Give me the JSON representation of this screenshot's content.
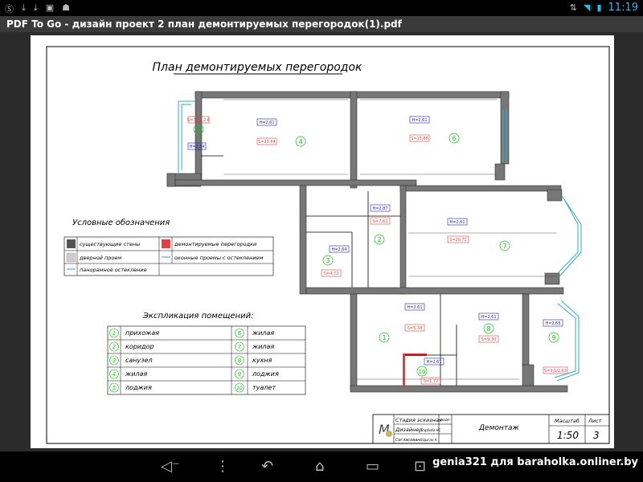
{
  "statusbar": {
    "time": "11:19",
    "left_icons": [
      "skype-icon",
      "download-icon",
      "download-icon",
      "image-icon",
      "android-icon"
    ],
    "right_icons": [
      "sync-icon",
      "wifi-icon",
      "battery-icon"
    ]
  },
  "app": {
    "title": "PDF To Go - дизайн проект 2 план демонтируемых перегородок(1).pdf"
  },
  "plan": {
    "title": "План демонтируемых перегородок",
    "legend_title": "Условные обозначения",
    "legend": [
      {
        "label": "существующие стены",
        "swatch": "#555555"
      },
      {
        "label": "демонтируемые перегородки",
        "swatch": "#e04040"
      },
      {
        "label": "дверной проем",
        "swatch": "#cccccc"
      },
      {
        "label": "оконные проемы с остеклением",
        "swatch": "#33aacc"
      },
      {
        "label": "панорамное остекление",
        "swatch": "#33aacc"
      }
    ],
    "explication_title": "Экспликация помещений:",
    "rooms": [
      {
        "num": "1",
        "name": "прихожая"
      },
      {
        "num": "2",
        "name": "коридор"
      },
      {
        "num": "3",
        "name": "санузел"
      },
      {
        "num": "4",
        "name": "жилая"
      },
      {
        "num": "5",
        "name": "лоджия"
      },
      {
        "num": "6",
        "name": "жилая"
      },
      {
        "num": "7",
        "name": "жилая"
      },
      {
        "num": "8",
        "name": "кухня"
      },
      {
        "num": "9",
        "name": "лоджия"
      },
      {
        "num": "10",
        "name": "туалет"
      }
    ],
    "room_tags": [
      {
        "num": "5",
        "h": "H=2,84",
        "s": "S=3,47,2,6"
      },
      {
        "num": "4",
        "h": "H=2,61",
        "s": "S=15,64"
      },
      {
        "num": "6",
        "h": "H=2,61",
        "s": "S=15,88"
      },
      {
        "num": "2",
        "h": "H=2,87",
        "s": "S=7,62"
      },
      {
        "num": "3",
        "h": "H=2,64",
        "s": "S=4,72"
      },
      {
        "num": "7",
        "h": "H=2,61",
        "s": "S=20,72"
      },
      {
        "num": "1",
        "h": "H=2,61",
        "s": "S=5,38"
      },
      {
        "num": "10",
        "h": "H=2,61",
        "s": "S=1,72"
      },
      {
        "num": "8",
        "h": "H=2,61",
        "s": "S=9,30"
      },
      {
        "num": "9",
        "h": "H=2,65",
        "s": "S=3,1/2,63"
      }
    ],
    "stamp": {
      "row1_label": "Стадия эскизная",
      "row1_col": "подп",
      "row2_label": "Дизайнер",
      "row2_value": "Зарбоба НС",
      "row3_label": "Согласовано",
      "row3_value": "Цыган А",
      "sheet_name": "Демонтаж",
      "scale_label": "Масштаб",
      "scale_value": "1:50",
      "sheet_label": "Лист",
      "sheet_value": "3"
    }
  },
  "watermark": "genia321 для baraholka.onliner.by"
}
